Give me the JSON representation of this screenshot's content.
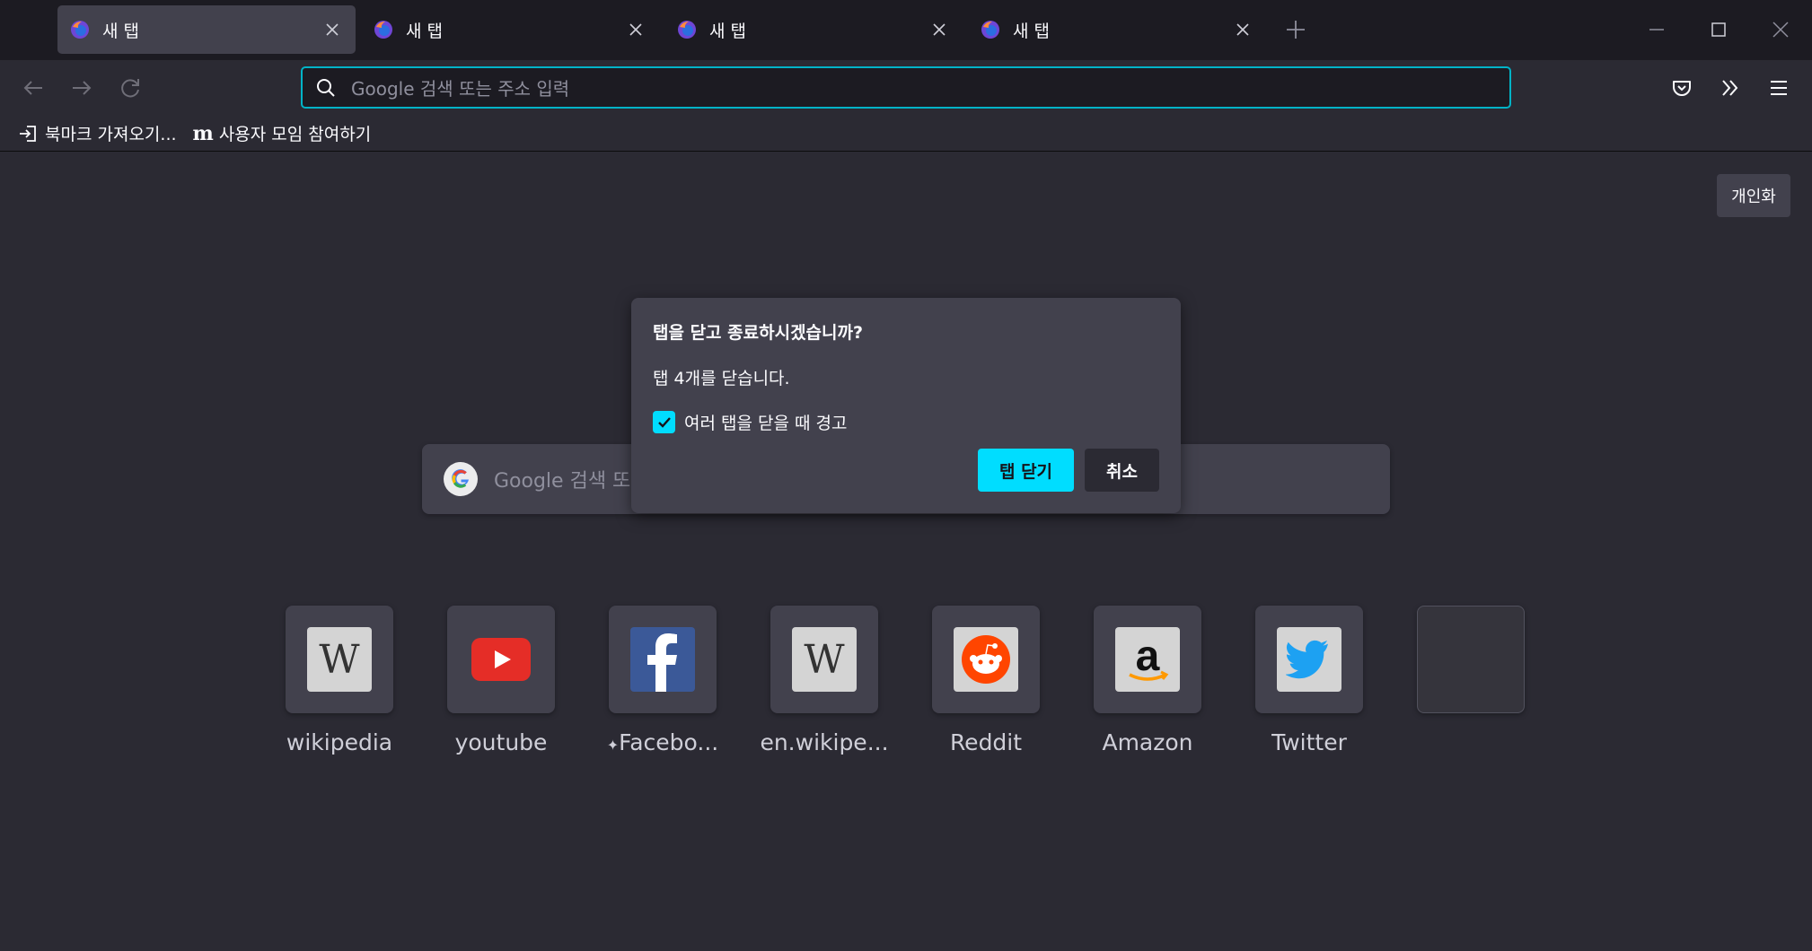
{
  "tabs": [
    {
      "title": "새 탭",
      "active": true
    },
    {
      "title": "새 탭",
      "active": false
    },
    {
      "title": "새 탭",
      "active": false
    },
    {
      "title": "새 탭",
      "active": false
    }
  ],
  "urlbar": {
    "placeholder": "Google 검색 또는 주소 입력"
  },
  "bookmarks": [
    {
      "label": "북마크 가져오기...",
      "icon": "import-icon"
    },
    {
      "label": "사용자 모임 참여하기",
      "icon": "mozilla-m-icon",
      "logo_text": "m"
    }
  ],
  "newtab": {
    "personalize_label": "개인화",
    "search_placeholder": "Google 검색 또는 주소 입력",
    "shortcuts": [
      {
        "label": "wikipedia",
        "icon": "wikipedia-icon",
        "glyph": "W"
      },
      {
        "label": "youtube",
        "icon": "youtube-icon"
      },
      {
        "label": "Facebo...",
        "icon": "facebook-icon",
        "pinned": true,
        "pin_glyph": "✦"
      },
      {
        "label": "en.wikipe...",
        "icon": "wikipedia-icon",
        "glyph": "W"
      },
      {
        "label": "Reddit",
        "icon": "reddit-icon"
      },
      {
        "label": "Amazon",
        "icon": "amazon-icon"
      },
      {
        "label": "Twitter",
        "icon": "twitter-icon"
      },
      {
        "label": "",
        "icon": "",
        "empty": true
      }
    ]
  },
  "dialog": {
    "title": "탭을 닫고 종료하시겠습니까?",
    "message": "탭 4개를 닫습니다.",
    "checkbox_label": "여러 탭을 닫을 때 경고",
    "checkbox_checked": true,
    "confirm_label": "탭 닫기",
    "cancel_label": "취소"
  },
  "colors": {
    "accent": "#00ddff",
    "urlbar_focus": "#00b3c7",
    "toolbar": "#2b2a33",
    "tabstrip": "#1c1b22"
  }
}
